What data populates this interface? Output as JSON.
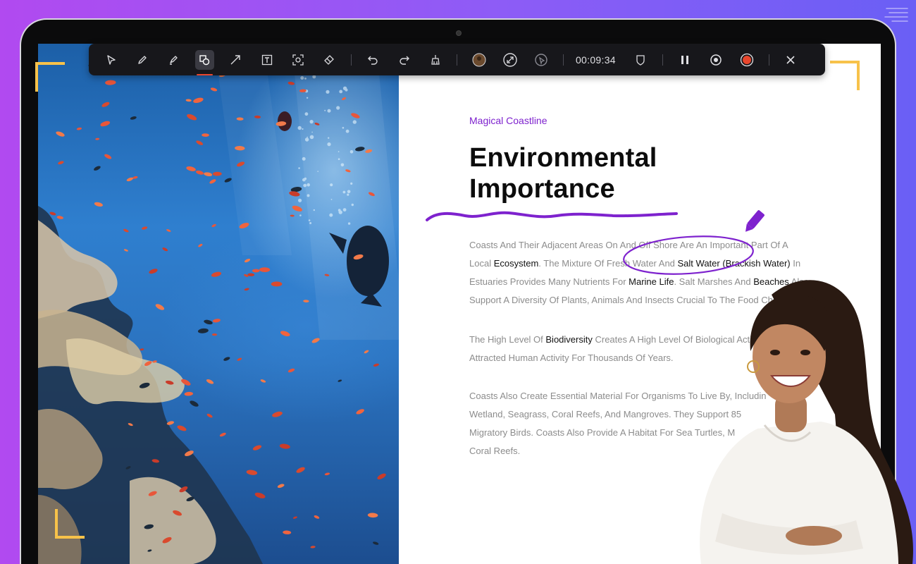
{
  "toolbar": {
    "tools": [
      {
        "name": "select-pointer-icon",
        "active": false
      },
      {
        "name": "pen-icon",
        "active": false
      },
      {
        "name": "highlighter-icon",
        "active": false
      },
      {
        "name": "shapes-icon",
        "active": true
      },
      {
        "name": "arrow-icon",
        "active": false
      },
      {
        "name": "text-icon",
        "active": false
      },
      {
        "name": "spotlight-icon",
        "active": false
      },
      {
        "name": "eraser-icon",
        "active": false
      }
    ],
    "timer": "00:09:34",
    "accent_color": "#e8462d"
  },
  "article": {
    "kicker": "Magical Coastline",
    "title_line1": "Environmental",
    "title_line2": "Importance",
    "paragraphs": [
      [
        {
          "t": "Coasts And Their Adjacent Areas On And Off Shore Are An Important Part Of A",
          "h": false
        },
        {
          "t": "\nLocal ",
          "h": false
        },
        {
          "t": "Ecosystem",
          "h": true
        },
        {
          "t": ". The Mixture Of Fresh Water And ",
          "h": false
        },
        {
          "t": "Salt Water (Brackish Water)",
          "h": true
        },
        {
          "t": " In",
          "h": false
        },
        {
          "t": "\nEstuaries Provides Many Nutrients For ",
          "h": false
        },
        {
          "t": "Marine Life",
          "h": true
        },
        {
          "t": ". Salt Marshes And ",
          "h": false
        },
        {
          "t": "Beaches",
          "h": true
        },
        {
          "t": " Also",
          "h": false
        },
        {
          "t": "\nSupport A Diversity Of Plants, Animals And Insects Crucial To The Food Chain.",
          "h": false
        }
      ],
      [
        {
          "t": "The High Level Of ",
          "h": false
        },
        {
          "t": "Biodiversity",
          "h": true
        },
        {
          "t": " Creates A High Level Of Biological Activity, Wh",
          "h": false
        },
        {
          "t": "\nAttracted Human Activity For Thousands Of Years.",
          "h": false
        }
      ],
      [
        {
          "t": "Coasts Also Create Essential Material For Organisms To Live By, Includin",
          "h": false
        },
        {
          "t": "\nWetland, Seagrass, Coral Reefs, And Mangroves. They Support 85",
          "h": false
        },
        {
          "t": "\nMigratory Birds. Coasts Also Provide A Habitat For Sea Turtles, M",
          "h": false
        },
        {
          "t": "\nCoral Reefs.",
          "h": false
        }
      ]
    ]
  },
  "colors": {
    "kicker": "#7e22ce",
    "scribble": "#7e22ce",
    "bracket": "#f7c24a",
    "background_gradient_start": "#b14af0",
    "background_gradient_end": "#6a5ff5"
  }
}
